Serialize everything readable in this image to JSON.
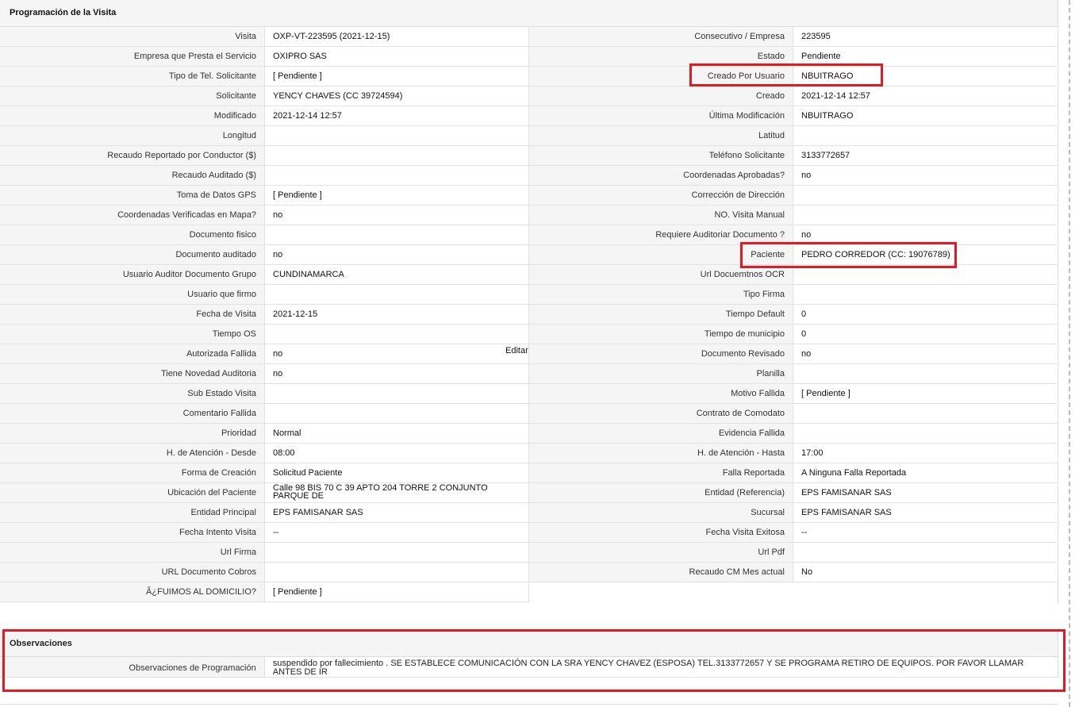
{
  "panel_title": "Programación de la Visita",
  "editar_label": "Editar",
  "left_rows": [
    {
      "label": "Visita",
      "value": "OXP-VT-223595 (2021-12-15)"
    },
    {
      "label": "Empresa que Presta el Servicio",
      "value": "OXIPRO SAS"
    },
    {
      "label": "Tipo de Tel. Solicitante",
      "value": "[ Pendiente ]"
    },
    {
      "label": "Solicitante",
      "value": "YENCY CHAVES (CC 39724594)"
    },
    {
      "label": "Modificado",
      "value": "2021-12-14 12:57"
    },
    {
      "label": "Longitud",
      "value": ""
    },
    {
      "label": "Recaudo Reportado por Conductor ($)",
      "value": ""
    },
    {
      "label": "Recaudo Auditado ($)",
      "value": ""
    },
    {
      "label": "Toma de Datos GPS",
      "value": "[ Pendiente ]"
    },
    {
      "label": "Coordenadas Verificadas en Mapa?",
      "value": " no"
    },
    {
      "label": "Documento fisico",
      "value": ""
    },
    {
      "label": "Documento auditado",
      "value": " no"
    },
    {
      "label": "Usuario Auditor Documento Grupo",
      "value": "CUNDINAMARCA"
    },
    {
      "label": "Usuario que firmo",
      "value": ""
    },
    {
      "label": "Fecha de Visita",
      "value": " 2021-12-15"
    },
    {
      "label": "Tiempo OS",
      "value": ""
    },
    {
      "label": "Autorizada Fallida",
      "value": " no"
    },
    {
      "label": "Tiene Novedad Auditoria",
      "value": " no"
    },
    {
      "label": "Sub Estado Visita",
      "value": ""
    },
    {
      "label": "Comentario Fallida",
      "value": ""
    },
    {
      "label": "Prioridad",
      "value": "Normal"
    },
    {
      "label": "H. de Atención - Desde",
      "value": "08:00"
    },
    {
      "label": "Forma de Creación",
      "value": "Solicitud Paciente"
    },
    {
      "label": "Ubicación del Paciente",
      "value": "Calle 98 BIS 70 C 39 APTO 204 TORRE 2 CONJUNTO PARQUE DE"
    },
    {
      "label": "Entidad Principal",
      "value": "EPS FAMISANAR SAS"
    },
    {
      "label": "Fecha Intento Visita",
      "value": " --"
    },
    {
      "label": "Url Firma",
      "value": ""
    },
    {
      "label": "URL Documento Cobros",
      "value": ""
    },
    {
      "label": "Â¿FUIMOS AL DOMICILIO?",
      "value": "[ Pendiente ]"
    }
  ],
  "right_rows": [
    {
      "label": "Consecutivo / Empresa",
      "value": "223595"
    },
    {
      "label": "Estado",
      "value": "Pendiente"
    },
    {
      "label": "Creado Por Usuario",
      "value": "NBUITRAGO"
    },
    {
      "label": "Creado",
      "value": "2021-12-14 12:57"
    },
    {
      "label": "Última Modificación",
      "value": " NBUITRAGO"
    },
    {
      "label": "Latitud",
      "value": ""
    },
    {
      "label": "Teléfono Solicitante",
      "value": "3133772657"
    },
    {
      "label": "Coordenadas Aprobadas?",
      "value": " no"
    },
    {
      "label": "Corrección de Dirección",
      "value": ""
    },
    {
      "label": "NO. Visita Manual",
      "value": ""
    },
    {
      "label": "Requiere Auditoriar Documento ?",
      "value": " no"
    },
    {
      "label": "Paciente",
      "value": "PEDRO CORREDOR (CC: 19076789)"
    },
    {
      "label": "Url Docuemtnos OCR",
      "value": ""
    },
    {
      "label": "Tipo Firma",
      "value": ""
    },
    {
      "label": "Tiempo Default",
      "value": "0"
    },
    {
      "label": "Tiempo de municipio",
      "value": "0"
    },
    {
      "label": "Documento Revisado",
      "value": " no"
    },
    {
      "label": "Planilla",
      "value": ""
    },
    {
      "label": "Motivo Fallida",
      "value": "[ Pendiente ]"
    },
    {
      "label": "Contrato de Comodato",
      "value": ""
    },
    {
      "label": "Evidencia Fallida",
      "value": ""
    },
    {
      "label": "H. de Atención - Hasta",
      "value": "17:00"
    },
    {
      "label": "Falla Reportada",
      "value": "A Ninguna Falla Reportada"
    },
    {
      "label": "Entidad (Referencia)",
      "value": "EPS FAMISANAR SAS"
    },
    {
      "label": "Sucursal",
      "value": "EPS FAMISANAR SAS"
    },
    {
      "label": "Fecha Visita Exitosa",
      "value": " --"
    },
    {
      "label": "Url Pdf",
      "value": ""
    },
    {
      "label": "Recaudo CM Mes actual",
      "value": "No"
    }
  ],
  "observaciones": {
    "title": "Observaciones",
    "label": "Observaciones de Programación",
    "value": " suspendido por fallecimiento . SE ESTABLECE COMUNICACIÓN CON LA SRA YENCY CHAVEZ (ESPOSA) TEL.3133772657 Y SE PROGRAMA RETIRO DE EQUIPOS. POR FAVOR LLAMAR ANTES DE IR"
  },
  "highlight_color": "#e11b22"
}
